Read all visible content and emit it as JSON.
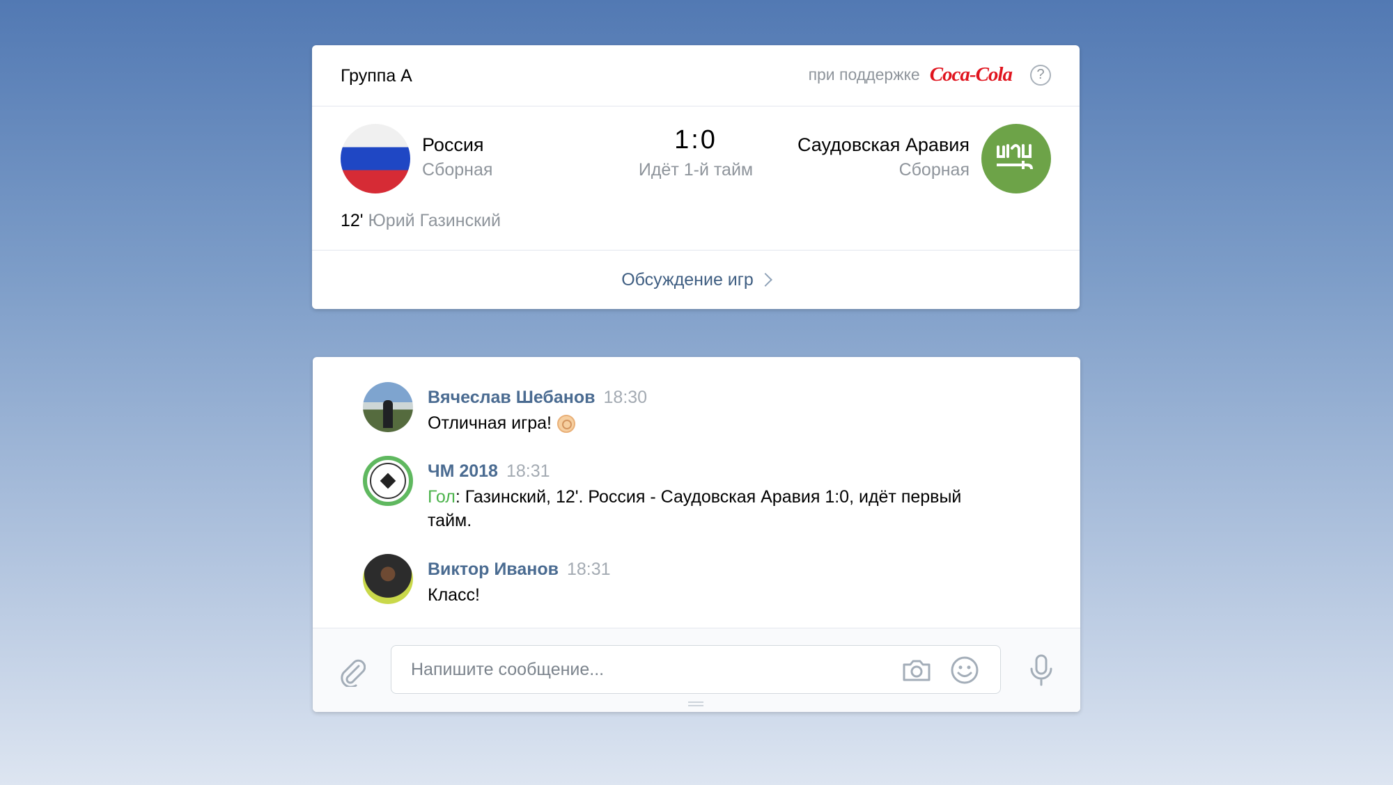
{
  "match": {
    "group_title": "Группа А",
    "sponsor_label": "при поддержке",
    "sponsor_logo_text": "Coca-Cola",
    "help_label": "?",
    "team1": {
      "name": "Россия",
      "subtitle": "Сборная"
    },
    "team2": {
      "name": "Саудовская Аравия",
      "subtitle": "Сборная"
    },
    "score": "1:0",
    "status": "Идёт 1-й тайм",
    "goal": {
      "minute": "12'",
      "player": "Юрий Газинский"
    },
    "discussion_link": "Обсуждение игр"
  },
  "chat": {
    "messages": [
      {
        "author": "Вячеслав Шебанов",
        "time": "18:30",
        "text": "Отличная игра!",
        "emoji": "ok-hand"
      },
      {
        "author": "ЧМ 2018",
        "time": "18:31",
        "goal_word": "Гол",
        "text": ": Газинский, 12'. Россия - Саудовская Аравия 1:0, идёт первый тайм."
      },
      {
        "author": "Виктор Иванов",
        "time": "18:31",
        "text": "Класс!"
      }
    ],
    "input_placeholder": "Напишите сообщение..."
  },
  "colors": {
    "link": "#3f5e82",
    "author": "#4a6b91",
    "goal_green": "#4bb34b",
    "sponsor_red": "#e0141e"
  }
}
